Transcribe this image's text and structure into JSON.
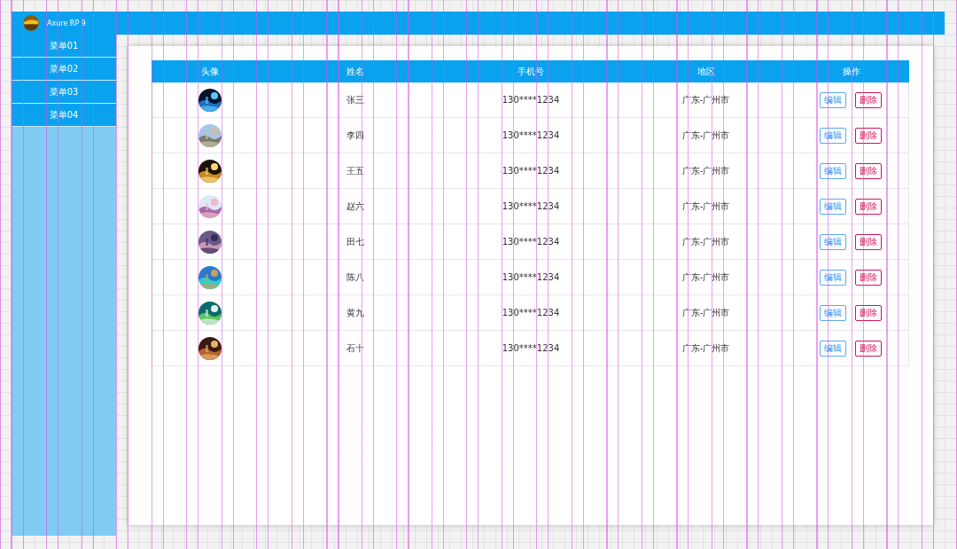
{
  "app_bar": {
    "title": "Axure RP 9"
  },
  "sidebar": {
    "items": [
      {
        "label": "菜单01"
      },
      {
        "label": "菜单02"
      },
      {
        "label": "菜单03"
      },
      {
        "label": "菜单04"
      }
    ]
  },
  "table": {
    "columns": [
      "头像",
      "姓名",
      "手机号",
      "地区",
      "操作"
    ],
    "rows": [
      {
        "name": "张三",
        "phone": "130****1234",
        "region": "广东-广州市",
        "actions": [
          "编辑",
          "删除"
        ]
      },
      {
        "name": "李四",
        "phone": "130****1234",
        "region": "广东-广州市",
        "actions": [
          "编辑",
          "删除"
        ]
      },
      {
        "name": "王五",
        "phone": "130****1234",
        "region": "广东-广州市",
        "actions": [
          "编辑",
          "删除"
        ]
      },
      {
        "name": "赵六",
        "phone": "130****1234",
        "region": "广东-广州市",
        "actions": [
          "编辑",
          "删除"
        ]
      },
      {
        "name": "田七",
        "phone": "130****1234",
        "region": "广东-广州市",
        "actions": [
          "编辑",
          "删除"
        ]
      },
      {
        "name": "陈八",
        "phone": "130****1234",
        "region": "广东-广州市",
        "actions": [
          "编辑",
          "删除"
        ]
      },
      {
        "name": "黄九",
        "phone": "130****1234",
        "region": "广东-广州市",
        "actions": [
          "编辑",
          "删除"
        ]
      },
      {
        "name": "石十",
        "phone": "130****1234",
        "region": "广东-广州市",
        "actions": [
          "编辑",
          "删除"
        ]
      }
    ]
  }
}
